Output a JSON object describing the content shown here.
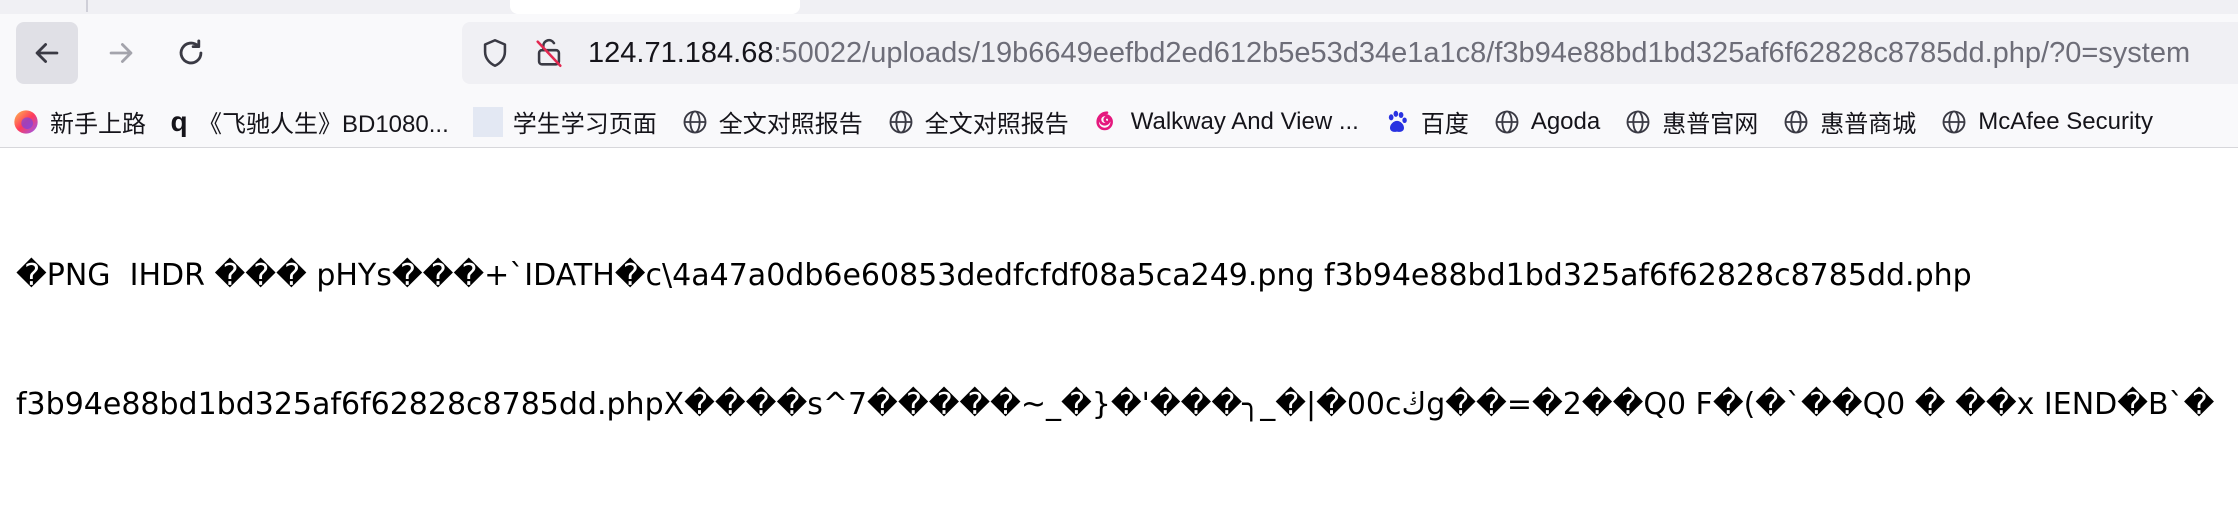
{
  "browser": {
    "url_host": "124.71.184.68",
    "url_path": ":50022/uploads/19b6649eefbd2ed612b5e53d34e1a1c8/f3b94e88bd1bd325af6f62828c8785dd.php/?0=system",
    "icons": {
      "back": "back-arrow-icon",
      "forward": "forward-arrow-icon",
      "reload": "reload-icon",
      "shield": "shield-icon",
      "insecure": "insecure-lock-icon"
    }
  },
  "bookmarks": [
    {
      "label": "新手上路",
      "icon": "firefox-icon"
    },
    {
      "label": "《飞驰人生》BD1080...",
      "icon": "q-glyph-icon"
    },
    {
      "label": "学生学习页面",
      "icon": "blank-page-icon"
    },
    {
      "label": "全文对照报告",
      "icon": "globe-icon"
    },
    {
      "label": "全文对照报告",
      "icon": "globe-icon"
    },
    {
      "label": "Walkway And View ...",
      "icon": "swirl-icon"
    },
    {
      "label": "百度",
      "icon": "baidu-paw-icon"
    },
    {
      "label": "Agoda",
      "icon": "globe-icon"
    },
    {
      "label": "惠普官网",
      "icon": "globe-icon"
    },
    {
      "label": "惠普商城",
      "icon": "globe-icon"
    },
    {
      "label": "McAfee Security",
      "icon": "globe-icon"
    }
  ],
  "page": {
    "line1": "�PNG  IHDR ��� pHYs���+`IDATH�c\\4a47a0db6e60853dedfcfdf08a5ca249.png f3b94e88bd1bd325af6f62828c8785dd.php",
    "line2": "f3b94e88bd1bd325af6f62828c8785dd.phpX����s^7�����~_�}�'���╮_�|�00cڬg��=�2��Q0 F�(�`��Q0 � ��x IEND�B`�"
  },
  "colors": {
    "url_path": "#6d6d78",
    "baidu_blue": "#2932e1",
    "swirl_pink": "#e5197e"
  }
}
